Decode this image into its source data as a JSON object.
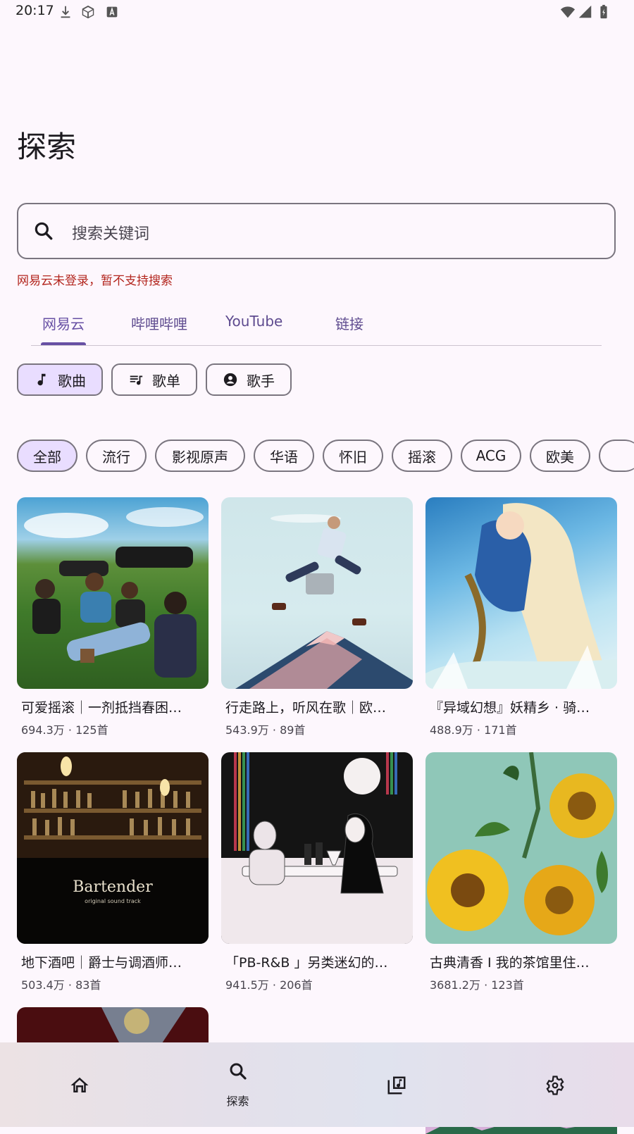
{
  "status_bar": {
    "time": "20:17"
  },
  "page": {
    "title": "探索"
  },
  "search": {
    "placeholder": "搜索关键词",
    "error": "网易云未登录，暂不支持搜索"
  },
  "tabs": [
    {
      "label": "网易云",
      "active": true
    },
    {
      "label": "哔哩哔哩",
      "active": false
    },
    {
      "label": "YouTube",
      "active": false
    },
    {
      "label": "链接",
      "active": false
    }
  ],
  "type_chips": [
    {
      "label": "歌曲",
      "icon": "music-note-icon",
      "selected": true
    },
    {
      "label": "歌单",
      "icon": "playlist-icon",
      "selected": false
    },
    {
      "label": "歌手",
      "icon": "account-circle-icon",
      "selected": false
    }
  ],
  "category_chips": [
    "全部",
    "流行",
    "影视原声",
    "华语",
    "怀旧",
    "摇滚",
    "ACG",
    "欧美"
  ],
  "playlists": [
    {
      "title": "可爱摇滚｜一剂抵挡春困…",
      "meta": "694.3万 · 125首"
    },
    {
      "title": "行走路上，听风在歌｜欧…",
      "meta": "543.9万 · 89首"
    },
    {
      "title": "『异域幻想』妖精乡 · 骑…",
      "meta": "488.9万 · 171首"
    },
    {
      "title": "地下酒吧｜爵士与调酒师…",
      "meta": "503.4万 · 83首"
    },
    {
      "title": "「PB-R&B 」另类迷幻的…",
      "meta": "941.5万 · 206首"
    },
    {
      "title": "古典清香 I 我的茶馆里住…",
      "meta": "3681.2万 · 123首"
    }
  ],
  "cover_texts": {
    "bartender_title": "Bartender",
    "bartender_sub": "original sound track"
  },
  "bottom_nav": [
    {
      "label": "",
      "icon": "home-icon"
    },
    {
      "label": "探索",
      "icon": "search-icon",
      "active": true
    },
    {
      "label": "",
      "icon": "library-music-icon"
    },
    {
      "label": "",
      "icon": "settings-icon"
    }
  ],
  "colors": {
    "accent": "#6750a4",
    "chip_selected": "#e9ddff",
    "error": "#b3261e",
    "background": "#fdf7fd"
  }
}
